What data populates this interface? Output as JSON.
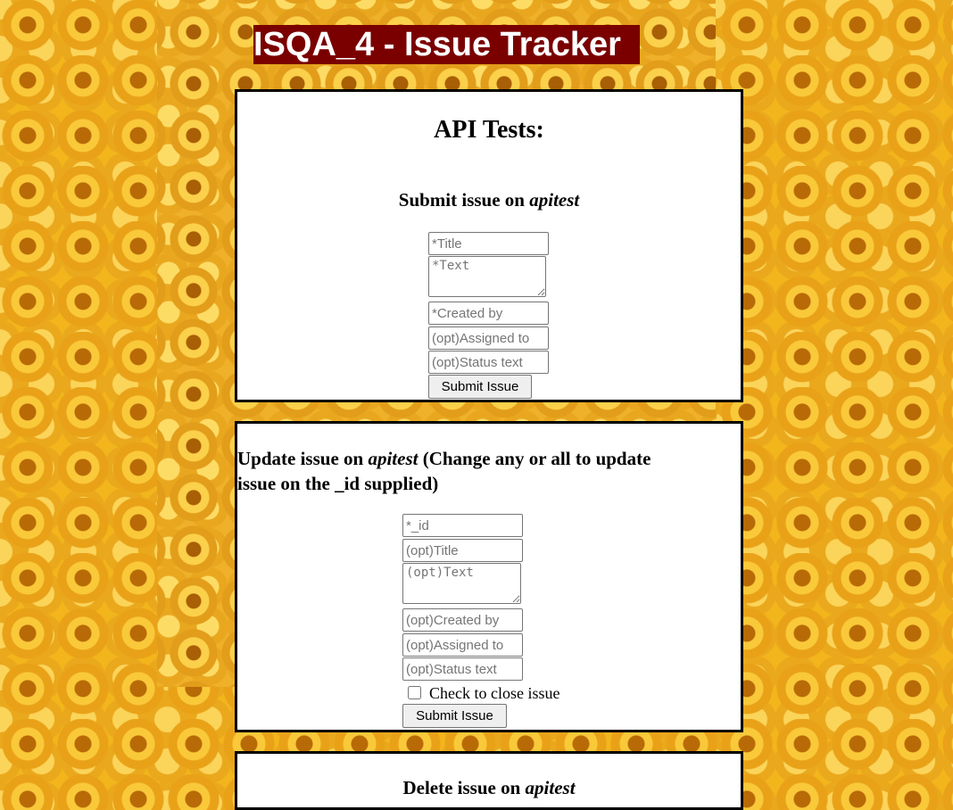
{
  "header": {
    "title": "ISQA_4 - Issue Tracker"
  },
  "api_tests": {
    "heading": "API Tests:",
    "submit": {
      "heading_prefix": "Submit issue on",
      "project": "apitest",
      "title_placeholder": "*Title",
      "text_placeholder": "*Text",
      "created_by_placeholder": "*Created by",
      "assigned_to_placeholder": "(opt)Assigned to",
      "status_text_placeholder": "(opt)Status text",
      "button_label": "Submit Issue"
    },
    "update": {
      "heading_prefix": "Update issue on",
      "project": "apitest",
      "heading_suffix_line1": "(Change any or all to update",
      "heading_suffix_line2": "issue on the _id supplied)",
      "id_placeholder": "*_id",
      "title_placeholder": "(opt)Title",
      "text_placeholder": "(opt)Text",
      "created_by_placeholder": "(opt)Created by",
      "assigned_to_placeholder": "(opt)Assigned to",
      "status_text_placeholder": "(opt)Status text",
      "close_label": "Check to close issue",
      "button_label": "Submit Issue"
    },
    "delete": {
      "heading_prefix": "Delete issue on",
      "project": "apitest"
    }
  }
}
